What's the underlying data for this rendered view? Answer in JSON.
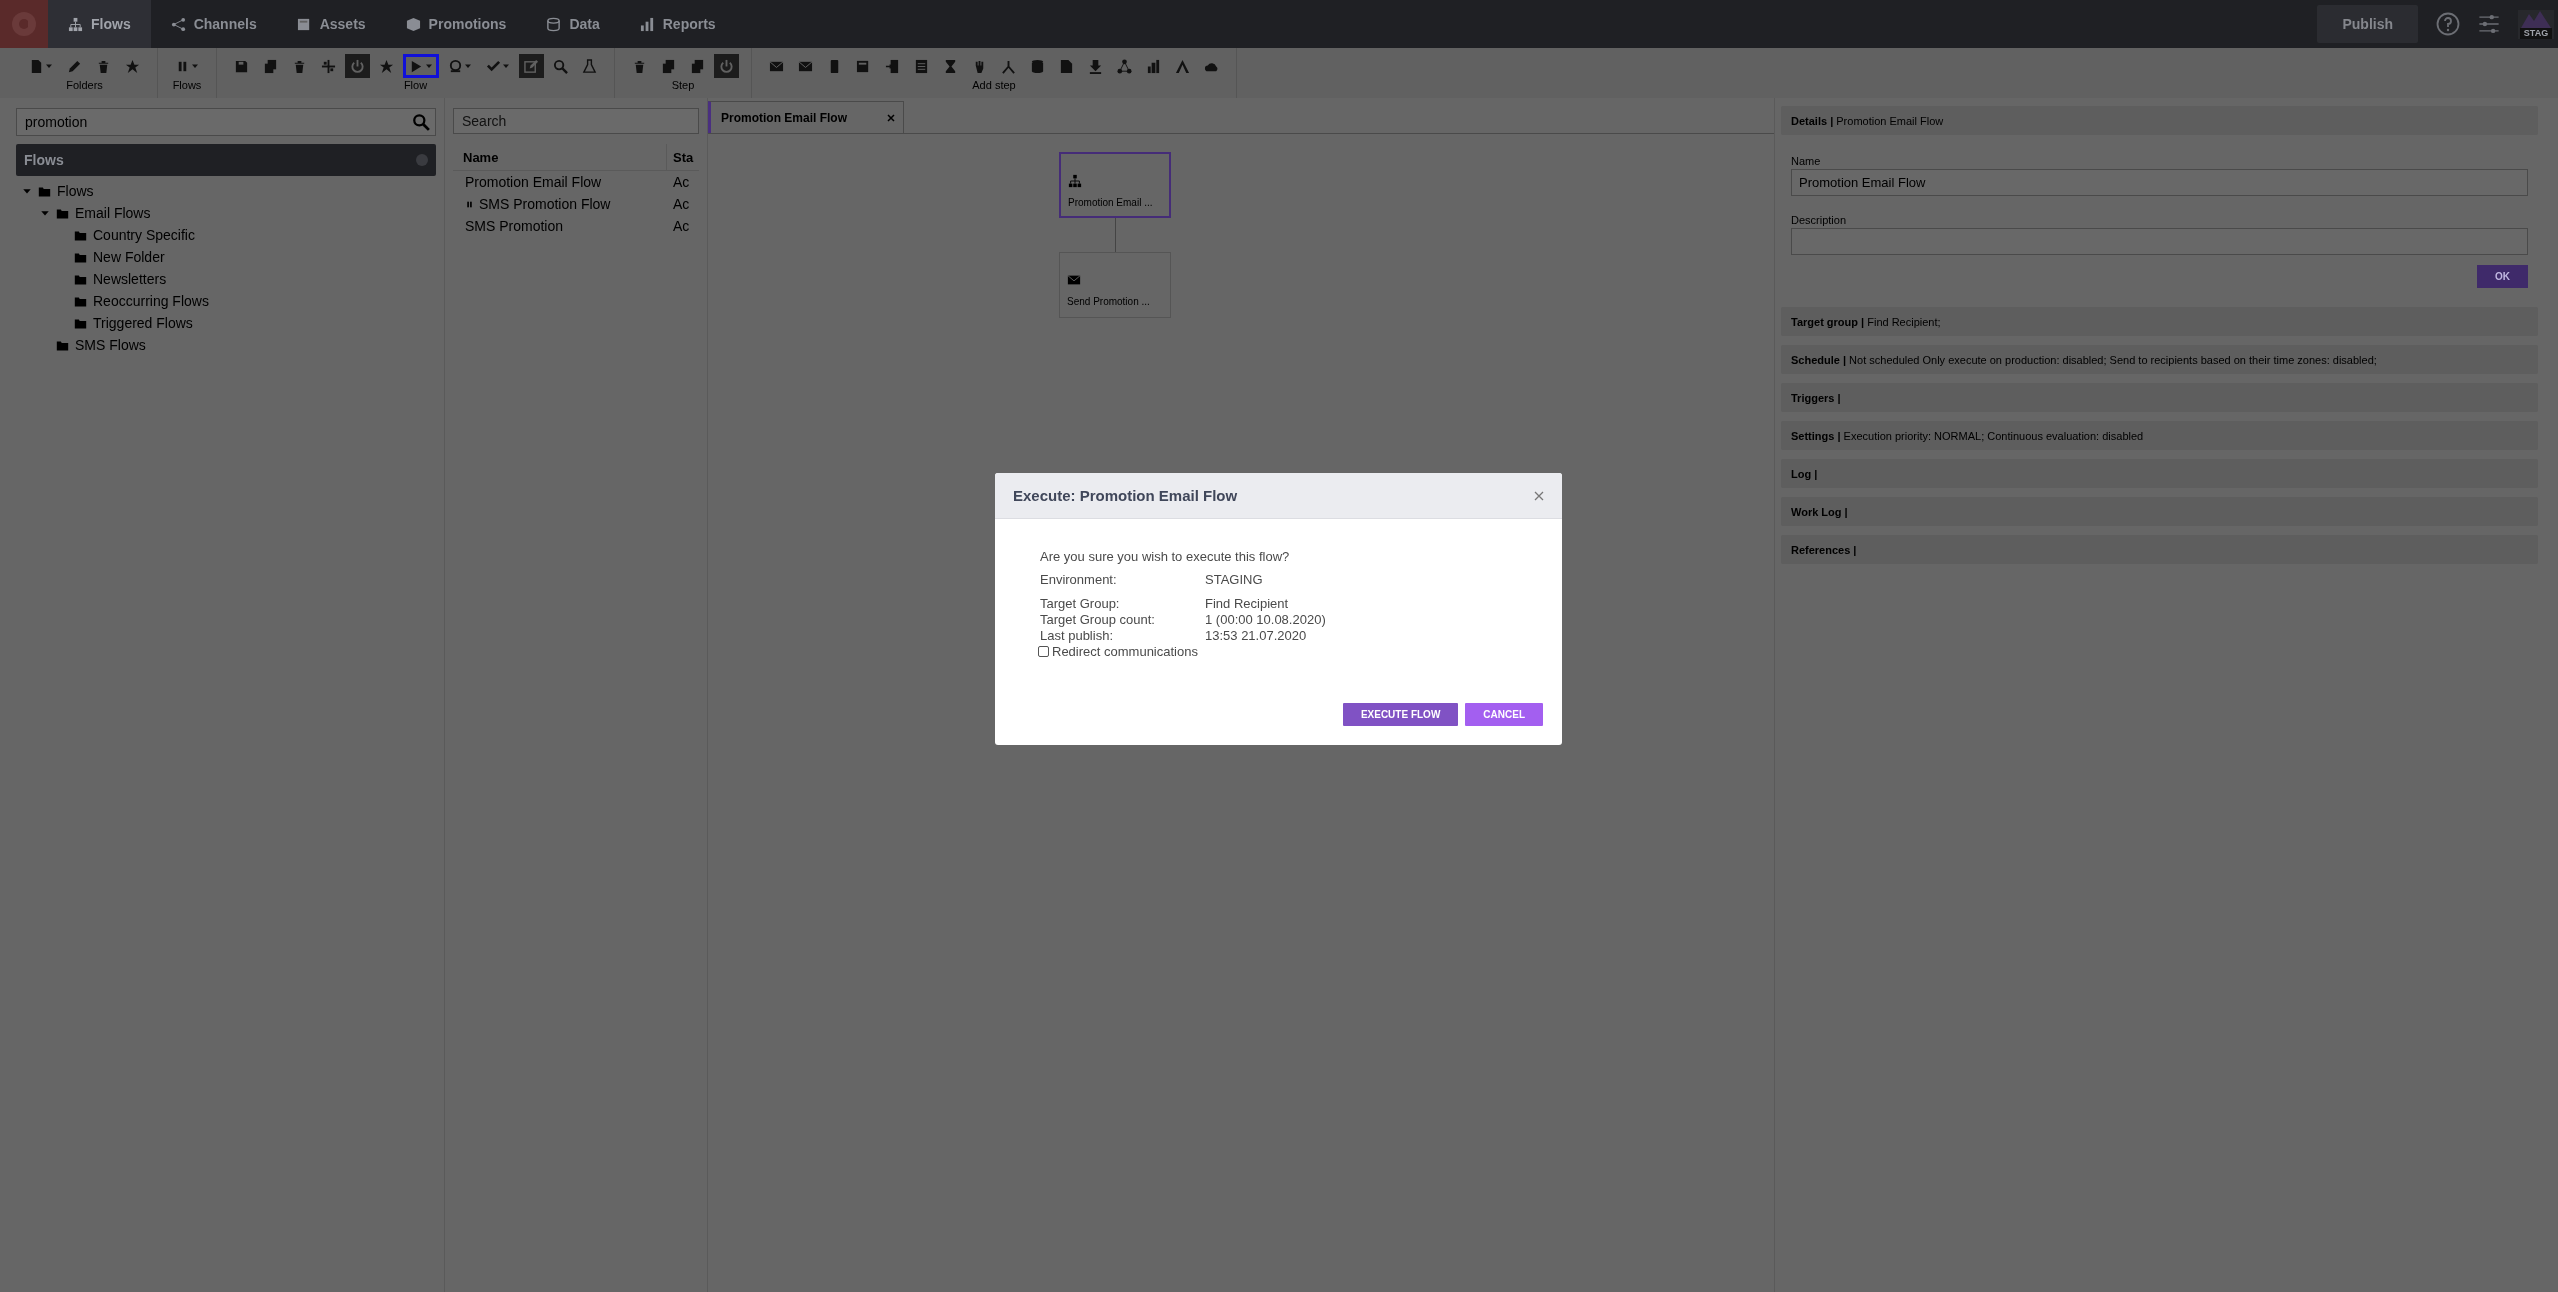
{
  "nav": {
    "tabs": [
      {
        "label": "Flows",
        "selected": true
      },
      {
        "label": "Channels",
        "selected": false
      },
      {
        "label": "Assets",
        "selected": false
      },
      {
        "label": "Promotions",
        "selected": false
      },
      {
        "label": "Data",
        "selected": false
      },
      {
        "label": "Reports",
        "selected": false
      }
    ],
    "publish": "Publish",
    "environment": "STAG"
  },
  "toolbar": {
    "groups": [
      {
        "label": "Folders",
        "buttons": [
          {
            "active": false,
            "focused": false
          },
          {
            "active": false,
            "focused": false
          },
          {
            "active": false,
            "focused": false
          },
          {
            "active": false,
            "focused": false
          }
        ]
      },
      {
        "label": "Flows",
        "buttons": [
          {
            "active": false,
            "focused": false
          }
        ]
      },
      {
        "label": "Flow",
        "buttons": [
          {
            "active": false,
            "focused": false
          },
          {
            "active": false,
            "focused": false
          },
          {
            "active": false,
            "focused": false
          },
          {
            "active": false,
            "focused": false
          },
          {
            "active": true,
            "focused": false
          },
          {
            "active": false,
            "focused": false
          },
          {
            "active": false,
            "focused": true
          },
          {
            "active": false,
            "focused": false
          },
          {
            "active": false,
            "focused": false
          },
          {
            "active": true,
            "focused": false
          },
          {
            "active": false,
            "focused": false
          },
          {
            "active": false,
            "focused": false
          }
        ]
      },
      {
        "label": "Step",
        "buttons": [
          {
            "active": false,
            "focused": false
          },
          {
            "active": false,
            "focused": false
          },
          {
            "active": false,
            "focused": false
          },
          {
            "active": true,
            "focused": false
          }
        ]
      },
      {
        "label": "Add step",
        "buttons": [
          {
            "active": false,
            "focused": false
          },
          {
            "active": false,
            "focused": false
          },
          {
            "active": false,
            "focused": false
          },
          {
            "active": false,
            "focused": false
          },
          {
            "active": false,
            "focused": false
          },
          {
            "active": false,
            "focused": false
          },
          {
            "active": false,
            "focused": false
          },
          {
            "active": false,
            "focused": false
          },
          {
            "active": false,
            "focused": false
          },
          {
            "active": false,
            "focused": false
          },
          {
            "active": false,
            "focused": false
          },
          {
            "active": false,
            "focused": false
          },
          {
            "active": false,
            "focused": false
          },
          {
            "active": false,
            "focused": false
          },
          {
            "active": false,
            "focused": false
          },
          {
            "active": false,
            "focused": false
          }
        ]
      }
    ]
  },
  "folders": {
    "search": {
      "value": "promotion"
    },
    "title": "Flows",
    "tree": [
      {
        "label": "Flows",
        "expanded": true,
        "children": [
          {
            "label": "Email Flows",
            "expanded": true,
            "children": [
              {
                "label": "Country Specific"
              },
              {
                "label": "New Folder"
              },
              {
                "label": "Newsletters"
              },
              {
                "label": "Reoccurring Flows"
              },
              {
                "label": "Triggered Flows"
              }
            ]
          },
          {
            "label": "SMS Flows"
          }
        ]
      }
    ]
  },
  "flow_list": {
    "search": {
      "placeholder": "Search"
    },
    "columns": [
      "Name",
      "Sta"
    ],
    "rows": [
      {
        "name": "Promotion Email Flow",
        "paused": false,
        "status": "Ac"
      },
      {
        "name": "SMS Promotion Flow",
        "paused": true,
        "status": "Ac"
      },
      {
        "name": "SMS Promotion",
        "paused": false,
        "status": "Ac"
      }
    ]
  },
  "editor": {
    "tab": {
      "label": "Promotion Email Flow",
      "selected": true
    },
    "nodes": [
      {
        "kind": "start",
        "label": "Promotion Email ...",
        "selected": true
      },
      {
        "kind": "email",
        "label": "Send Promotion ...",
        "selected": false
      }
    ]
  },
  "details": {
    "header": {
      "title": "Details |",
      "subtitle": "Promotion Email Flow"
    },
    "name_label": "Name",
    "name_value": "Promotion Email Flow",
    "description_label": "Description",
    "ok": "OK",
    "sections": [
      {
        "title": "Target group |",
        "text": "Find Recipient;"
      },
      {
        "title": "Schedule |",
        "text": "Not scheduled Only execute on production: disabled; Send to recipients based on their time zones: disabled;"
      },
      {
        "title": "Triggers |"
      },
      {
        "title": "Settings |",
        "text": "Execution priority: NORMAL; Continuous evaluation: disabled"
      },
      {
        "title": "Log |"
      },
      {
        "title": "Work Log |"
      },
      {
        "title": "References |"
      }
    ]
  },
  "dialog": {
    "title": "Execute: Promotion Email Flow",
    "question": "Are you sure you wish to execute this flow?",
    "fields": [
      {
        "label": "Environment:",
        "value": "STAGING"
      },
      {
        "label": "Target Group:",
        "value": "Find Recipient"
      },
      {
        "label": "Target Group count:",
        "value": "1 (00:00 10.08.2020)"
      },
      {
        "label": "Last publish:",
        "value": "13:53 21.07.2020"
      }
    ],
    "redirect": {
      "label": "Redirect communications",
      "checked": false
    },
    "buttons": [
      {
        "label": "EXECUTE FLOW",
        "kind": "primary"
      },
      {
        "label": "CANCEL",
        "kind": "secondary"
      }
    ]
  }
}
